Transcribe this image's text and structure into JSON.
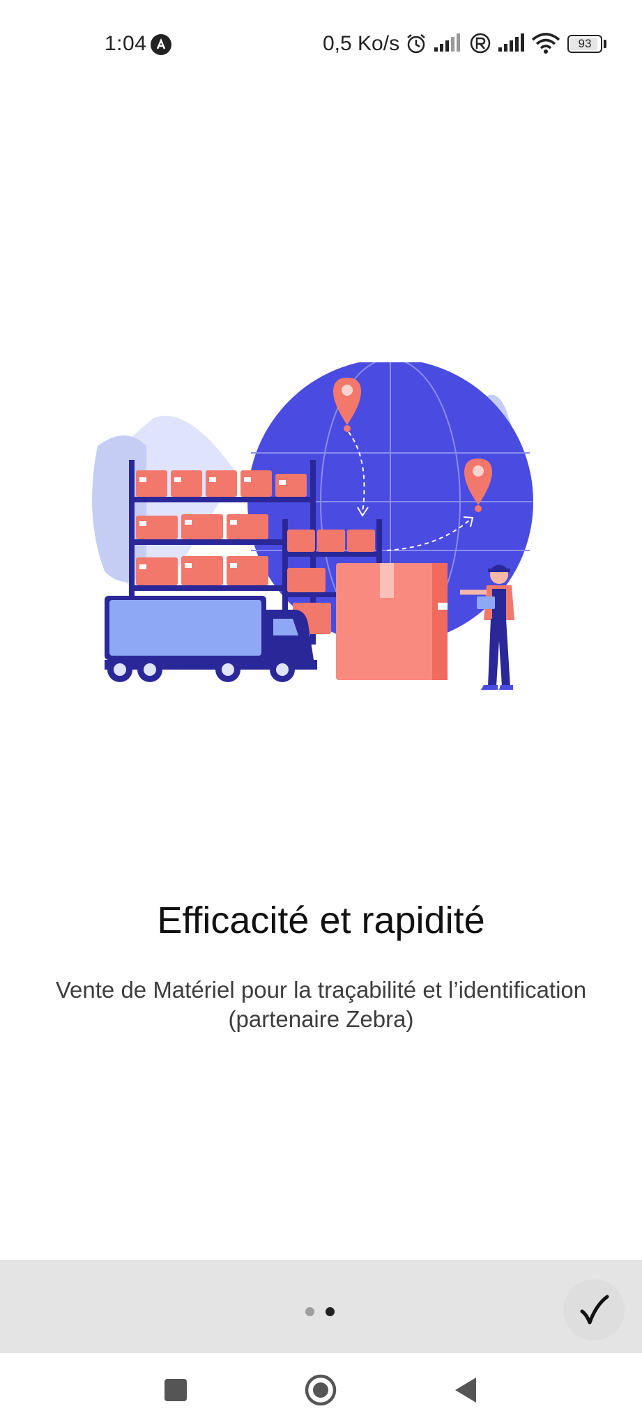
{
  "status_bar": {
    "time": "1:04",
    "network_speed": "0,5 Ko/s",
    "battery_level": "93",
    "battery_percent": 93,
    "icons": [
      "app-notification-icon",
      "alarm-icon",
      "signal-icon",
      "roaming-icon",
      "signal-icon",
      "wifi-icon",
      "battery-icon"
    ]
  },
  "onboarding": {
    "illustration": "warehouse-logistics-illustration",
    "title": "Efficacité et rapidité",
    "subtitle": "Vente de Matériel pour la traçabilité et l’identification (partenaire Zebra)"
  },
  "pager": {
    "page_count": 2,
    "current_page": 2,
    "active_color": "#222222",
    "inactive_color": "#9e9e9e"
  },
  "done_button": {
    "icon": "check-icon",
    "glyph": "✓"
  },
  "navigation": {
    "buttons": [
      "recents-square-icon",
      "home-circle-icon",
      "back-triangle-icon"
    ]
  },
  "colors": {
    "accent_blue": "#4a4be0",
    "box_salmon": "#f2786c",
    "shelf_navy": "#2a2899",
    "light_blue": "#c5cdf5"
  }
}
